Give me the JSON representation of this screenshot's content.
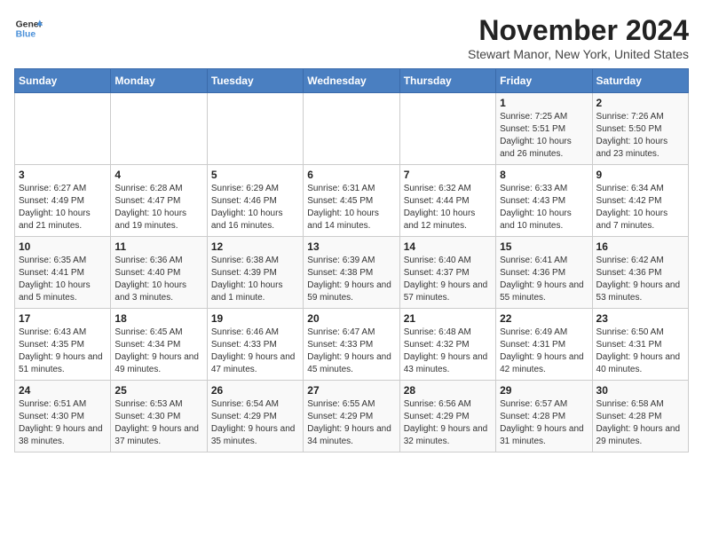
{
  "logo": {
    "line1": "General",
    "line2": "Blue"
  },
  "title": "November 2024",
  "location": "Stewart Manor, New York, United States",
  "days_of_week": [
    "Sunday",
    "Monday",
    "Tuesday",
    "Wednesday",
    "Thursday",
    "Friday",
    "Saturday"
  ],
  "weeks": [
    [
      {
        "day": "",
        "info": ""
      },
      {
        "day": "",
        "info": ""
      },
      {
        "day": "",
        "info": ""
      },
      {
        "day": "",
        "info": ""
      },
      {
        "day": "",
        "info": ""
      },
      {
        "day": "1",
        "info": "Sunrise: 7:25 AM\nSunset: 5:51 PM\nDaylight: 10 hours and 26 minutes."
      },
      {
        "day": "2",
        "info": "Sunrise: 7:26 AM\nSunset: 5:50 PM\nDaylight: 10 hours and 23 minutes."
      }
    ],
    [
      {
        "day": "3",
        "info": "Sunrise: 6:27 AM\nSunset: 4:49 PM\nDaylight: 10 hours and 21 minutes."
      },
      {
        "day": "4",
        "info": "Sunrise: 6:28 AM\nSunset: 4:47 PM\nDaylight: 10 hours and 19 minutes."
      },
      {
        "day": "5",
        "info": "Sunrise: 6:29 AM\nSunset: 4:46 PM\nDaylight: 10 hours and 16 minutes."
      },
      {
        "day": "6",
        "info": "Sunrise: 6:31 AM\nSunset: 4:45 PM\nDaylight: 10 hours and 14 minutes."
      },
      {
        "day": "7",
        "info": "Sunrise: 6:32 AM\nSunset: 4:44 PM\nDaylight: 10 hours and 12 minutes."
      },
      {
        "day": "8",
        "info": "Sunrise: 6:33 AM\nSunset: 4:43 PM\nDaylight: 10 hours and 10 minutes."
      },
      {
        "day": "9",
        "info": "Sunrise: 6:34 AM\nSunset: 4:42 PM\nDaylight: 10 hours and 7 minutes."
      }
    ],
    [
      {
        "day": "10",
        "info": "Sunrise: 6:35 AM\nSunset: 4:41 PM\nDaylight: 10 hours and 5 minutes."
      },
      {
        "day": "11",
        "info": "Sunrise: 6:36 AM\nSunset: 4:40 PM\nDaylight: 10 hours and 3 minutes."
      },
      {
        "day": "12",
        "info": "Sunrise: 6:38 AM\nSunset: 4:39 PM\nDaylight: 10 hours and 1 minute."
      },
      {
        "day": "13",
        "info": "Sunrise: 6:39 AM\nSunset: 4:38 PM\nDaylight: 9 hours and 59 minutes."
      },
      {
        "day": "14",
        "info": "Sunrise: 6:40 AM\nSunset: 4:37 PM\nDaylight: 9 hours and 57 minutes."
      },
      {
        "day": "15",
        "info": "Sunrise: 6:41 AM\nSunset: 4:36 PM\nDaylight: 9 hours and 55 minutes."
      },
      {
        "day": "16",
        "info": "Sunrise: 6:42 AM\nSunset: 4:36 PM\nDaylight: 9 hours and 53 minutes."
      }
    ],
    [
      {
        "day": "17",
        "info": "Sunrise: 6:43 AM\nSunset: 4:35 PM\nDaylight: 9 hours and 51 minutes."
      },
      {
        "day": "18",
        "info": "Sunrise: 6:45 AM\nSunset: 4:34 PM\nDaylight: 9 hours and 49 minutes."
      },
      {
        "day": "19",
        "info": "Sunrise: 6:46 AM\nSunset: 4:33 PM\nDaylight: 9 hours and 47 minutes."
      },
      {
        "day": "20",
        "info": "Sunrise: 6:47 AM\nSunset: 4:33 PM\nDaylight: 9 hours and 45 minutes."
      },
      {
        "day": "21",
        "info": "Sunrise: 6:48 AM\nSunset: 4:32 PM\nDaylight: 9 hours and 43 minutes."
      },
      {
        "day": "22",
        "info": "Sunrise: 6:49 AM\nSunset: 4:31 PM\nDaylight: 9 hours and 42 minutes."
      },
      {
        "day": "23",
        "info": "Sunrise: 6:50 AM\nSunset: 4:31 PM\nDaylight: 9 hours and 40 minutes."
      }
    ],
    [
      {
        "day": "24",
        "info": "Sunrise: 6:51 AM\nSunset: 4:30 PM\nDaylight: 9 hours and 38 minutes."
      },
      {
        "day": "25",
        "info": "Sunrise: 6:53 AM\nSunset: 4:30 PM\nDaylight: 9 hours and 37 minutes."
      },
      {
        "day": "26",
        "info": "Sunrise: 6:54 AM\nSunset: 4:29 PM\nDaylight: 9 hours and 35 minutes."
      },
      {
        "day": "27",
        "info": "Sunrise: 6:55 AM\nSunset: 4:29 PM\nDaylight: 9 hours and 34 minutes."
      },
      {
        "day": "28",
        "info": "Sunrise: 6:56 AM\nSunset: 4:29 PM\nDaylight: 9 hours and 32 minutes."
      },
      {
        "day": "29",
        "info": "Sunrise: 6:57 AM\nSunset: 4:28 PM\nDaylight: 9 hours and 31 minutes."
      },
      {
        "day": "30",
        "info": "Sunrise: 6:58 AM\nSunset: 4:28 PM\nDaylight: 9 hours and 29 minutes."
      }
    ]
  ]
}
